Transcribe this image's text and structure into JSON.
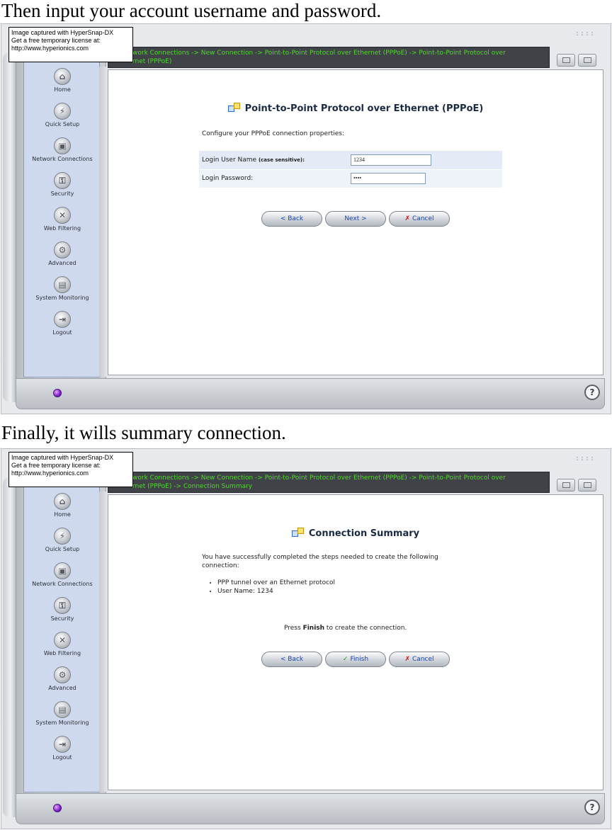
{
  "captions": {
    "first": "Then input your account username and password.",
    "second": "Finally, it wills summary connection."
  },
  "watermark": {
    "line1": "Image captured with HyperSnap-DX",
    "line2": "Get a free temporary license at:",
    "line3": "http://www.hyperionics.com"
  },
  "nav": [
    {
      "label": "Home",
      "icon": "home-icon",
      "glyph": "⌂"
    },
    {
      "label": "Quick Setup",
      "icon": "lightning-icon",
      "glyph": "⚡"
    },
    {
      "label": "Network Connections",
      "icon": "network-icon",
      "glyph": "▣"
    },
    {
      "label": "Security",
      "icon": "lock-icon",
      "glyph": "⚿"
    },
    {
      "label": "Web Filtering",
      "icon": "filter-icon",
      "glyph": "✕"
    },
    {
      "label": "Advanced",
      "icon": "advanced-icon",
      "glyph": "⚙"
    },
    {
      "label": "System Monitoring",
      "icon": "monitor-icon",
      "glyph": "▤"
    },
    {
      "label": "Logout",
      "icon": "logout-icon",
      "glyph": "⇥"
    }
  ],
  "screen1": {
    "breadcrumb_line1": "work Connections -> New Connection -> Point-to-Point Protocol over Ethernet (PPPoE) -> Point-to-Point Protocol over",
    "breadcrumb_line2": "rnet (PPPoE)",
    "title": "Point-to-Point Protocol over Ethernet (PPPoE)",
    "intro": "Configure your PPPoE connection properties:",
    "username_label": "Login User Name",
    "username_note": "(case sensitive):",
    "username_value": "1234",
    "password_label": "Login Password:",
    "password_value": "••••",
    "buttons": {
      "back": "< Back",
      "next": "Next >",
      "cancel": "Cancel"
    }
  },
  "screen2": {
    "breadcrumb_line1": "work Connections -> New Connection -> Point-to-Point Protocol over Ethernet (PPPoE) -> Point-to-Point Protocol over",
    "breadcrumb_line2": "rnet (PPPoE) -> Connection Summary",
    "title": "Connection Summary",
    "intro_line1": "You have successfully completed the steps needed to create the following",
    "intro_line2": "connection:",
    "bullets": [
      "PPP tunnel over an Ethernet protocol",
      "User Name: 1234"
    ],
    "finish_prefix": "Press ",
    "finish_bold": "Finish",
    "finish_suffix": " to create the connection.",
    "buttons": {
      "back": "< Back",
      "finish": "Finish",
      "cancel": "Cancel"
    }
  },
  "help_glyph": "?",
  "grip": "::::"
}
